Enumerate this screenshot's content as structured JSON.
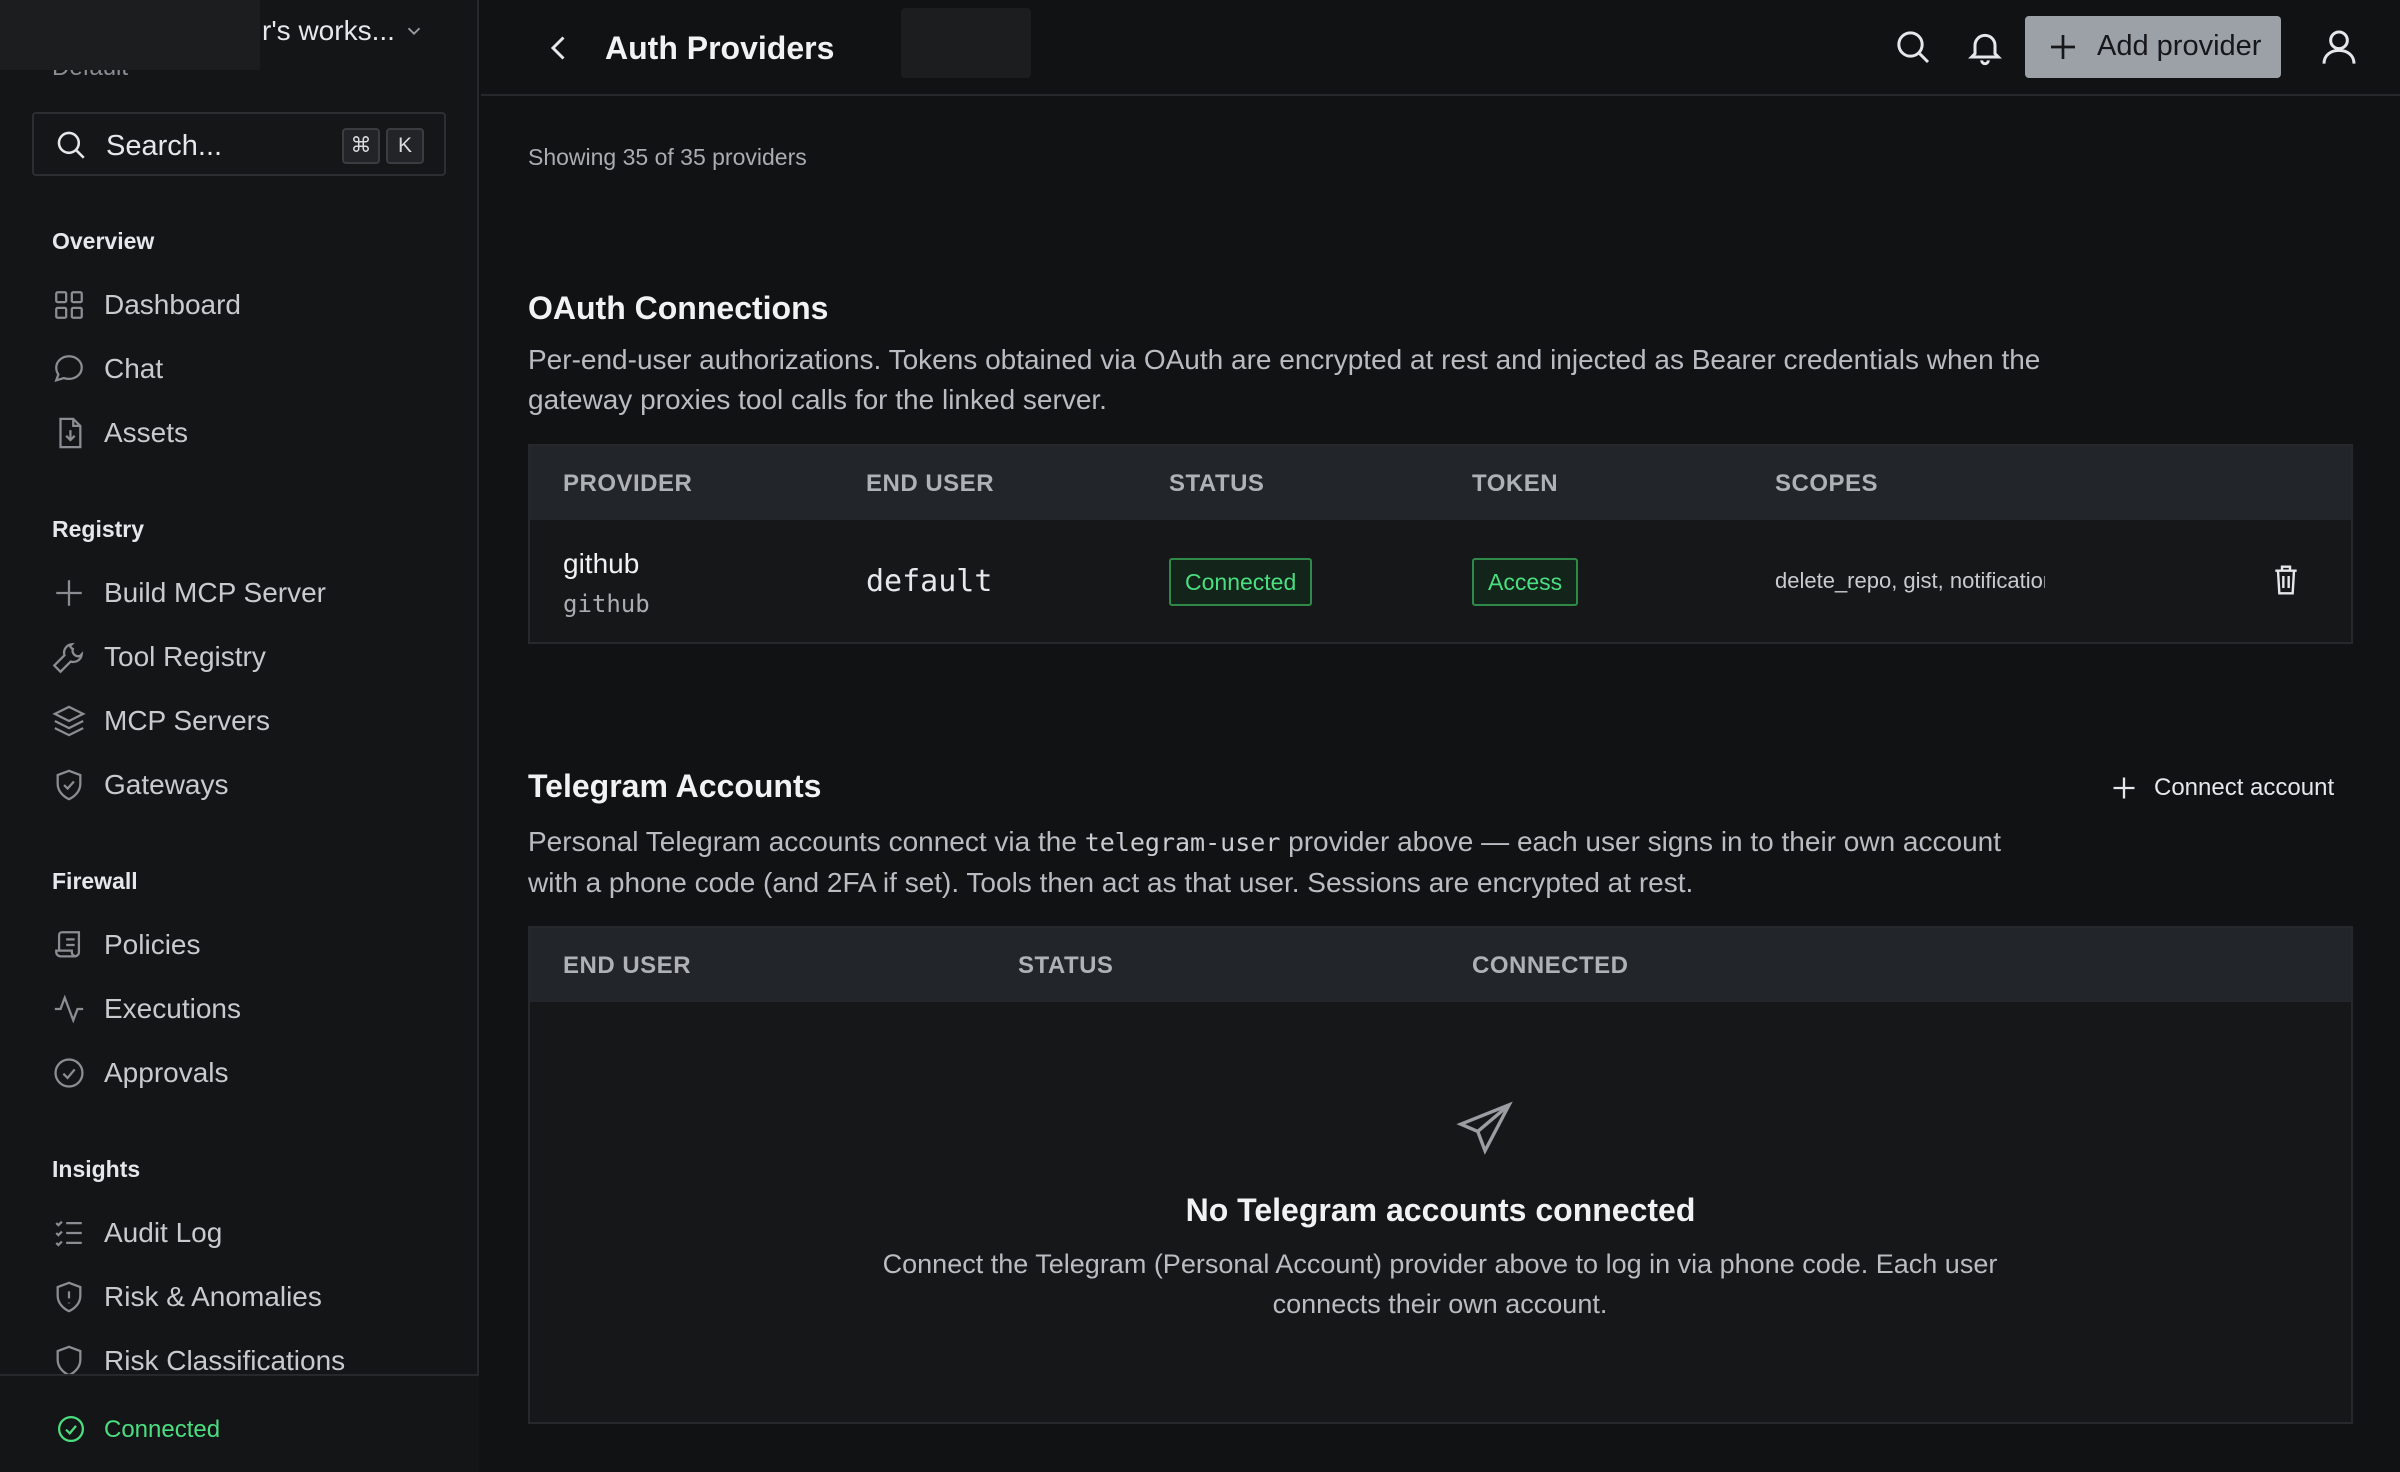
{
  "sidebar": {
    "workspace_name": "r's works...",
    "workspace_sub": "Default",
    "search": {
      "placeholder": "Search...",
      "shortcut_cmd": "⌘",
      "shortcut_key": "K"
    },
    "sections": {
      "overview": "Overview",
      "registry": "Registry",
      "firewall": "Firewall",
      "insights": "Insights"
    },
    "items": {
      "dashboard": "Dashboard",
      "chat": "Chat",
      "assets": "Assets",
      "build_mcp_server": "Build MCP Server",
      "tool_registry": "Tool Registry",
      "mcp_servers": "MCP Servers",
      "gateways": "Gateways",
      "policies": "Policies",
      "executions": "Executions",
      "approvals": "Approvals",
      "audit_log": "Audit Log",
      "risk_anomalies": "Risk & Anomalies",
      "risk_classifications": "Risk Classifications"
    },
    "footer_status": "Connected"
  },
  "topbar": {
    "title": "Auth Providers",
    "add_provider_label": "Add provider"
  },
  "main": {
    "showing_text": "Showing 35 of 35 providers",
    "oauth": {
      "title": "OAuth Connections",
      "description": "Per-end-user authorizations. Tokens obtained via OAuth are encrypted at rest and injected as Bearer credentials when the gateway proxies tool calls for the linked server.",
      "columns": [
        "PROVIDER",
        "END USER",
        "STATUS",
        "TOKEN",
        "SCOPES"
      ],
      "rows": [
        {
          "provider": "github",
          "provider_id": "github",
          "end_user": "default",
          "status": "Connected",
          "token": "Access",
          "scopes": "delete_repo, gist, notifications"
        }
      ]
    },
    "telegram": {
      "title": "Telegram Accounts",
      "connect_label": "Connect account",
      "description_pre": "Personal Telegram accounts connect via the ",
      "description_code": "telegram-user",
      "description_post": " provider above — each user signs in to their own account with a phone code (and 2FA if set). Tools then act as that user. Sessions are encrypted at rest.",
      "columns": [
        "END USER",
        "STATUS",
        "CONNECTED"
      ],
      "empty_title": "No Telegram accounts connected",
      "empty_description": "Connect the Telegram (Personal Account) provider above to log in via phone code. Each user connects their own account."
    }
  },
  "colors": {
    "accent_green": "#4ade80",
    "button_gray": "#9ca1a8",
    "background": "#111214"
  }
}
